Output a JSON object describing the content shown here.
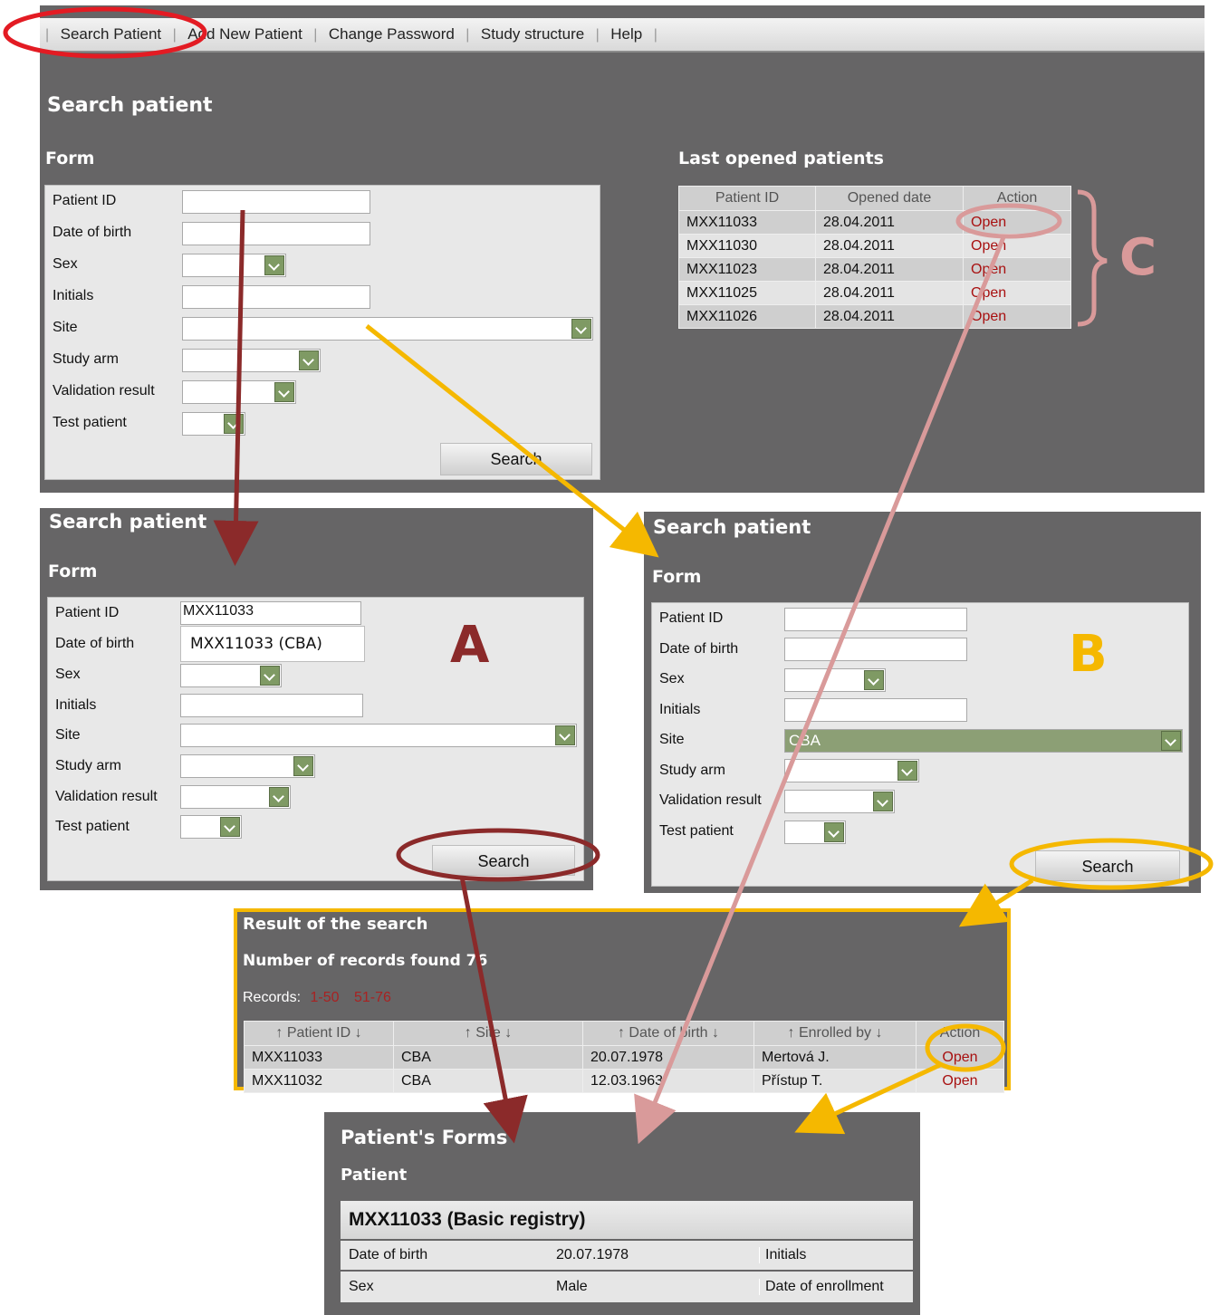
{
  "menu": {
    "items": [
      "Search Patient",
      "Add New Patient",
      "Change Password",
      "Study structure",
      "Help"
    ]
  },
  "search_main": {
    "title": "Search patient",
    "form_title": "Form",
    "labels": [
      "Patient ID",
      "Date of birth",
      "Sex",
      "Initials",
      "Site",
      "Study arm",
      "Validation result",
      "Test patient"
    ],
    "search_button": "Search"
  },
  "last_opened": {
    "title": "Last opened patients",
    "columns": [
      "Patient ID",
      "Opened date",
      "Action"
    ],
    "rows": [
      [
        "MXX11033",
        "28.04.2011",
        "Open"
      ],
      [
        "MXX11030",
        "28.04.2011",
        "Open"
      ],
      [
        "MXX11023",
        "28.04.2011",
        "Open"
      ],
      [
        "MXX11025",
        "28.04.2011",
        "Open"
      ],
      [
        "MXX11026",
        "28.04.2011",
        "Open"
      ]
    ]
  },
  "panel_a": {
    "title": "Search patient",
    "form_title": "Form",
    "labels": [
      "Patient ID",
      "Date of birth",
      "Sex",
      "Initials",
      "Site",
      "Study arm",
      "Validation result",
      "Test patient"
    ],
    "patient_id_value": "MXX11033",
    "suggestion": "MXX11033 (CBA)",
    "search_button": "Search",
    "marker": "A"
  },
  "panel_b": {
    "title": "Search patient",
    "form_title": "Form",
    "labels": [
      "Patient ID",
      "Date of birth",
      "Sex",
      "Initials",
      "Site",
      "Study arm",
      "Validation result",
      "Test patient"
    ],
    "site_value": "CBA",
    "search_button": "Search",
    "marker": "B"
  },
  "marker_c": "C",
  "results": {
    "title": "Result of the search",
    "count_text": "Number of records found 76",
    "records_label": "Records:",
    "page_links": [
      "1-50",
      "51-76"
    ],
    "columns": [
      "Patient ID",
      "Site",
      "Date of birth",
      "Enrolled by",
      "Action"
    ],
    "rows": [
      [
        "MXX11033",
        "CBA",
        "20.07.1978",
        "Mertová J.",
        "Open"
      ],
      [
        "MXX11032",
        "CBA",
        "12.03.1963",
        "Přístup T.",
        "Open"
      ]
    ]
  },
  "patient_forms": {
    "title": "Patient's Forms",
    "subtitle": "Patient",
    "patient_header": "MXX11033 (Basic registry)",
    "rows": [
      [
        "Date of birth",
        "20.07.1978",
        "Initials"
      ],
      [
        "Sex",
        "Male",
        "Date of enrollment"
      ]
    ]
  },
  "colors": {
    "panel": "#666566",
    "annotation_red": "#e31b23",
    "arrow_darkred": "#8b2a2a",
    "arrow_yellow": "#f5b800",
    "arrow_pink": "#d99a9a",
    "select_arrow": "#7f9a64"
  }
}
